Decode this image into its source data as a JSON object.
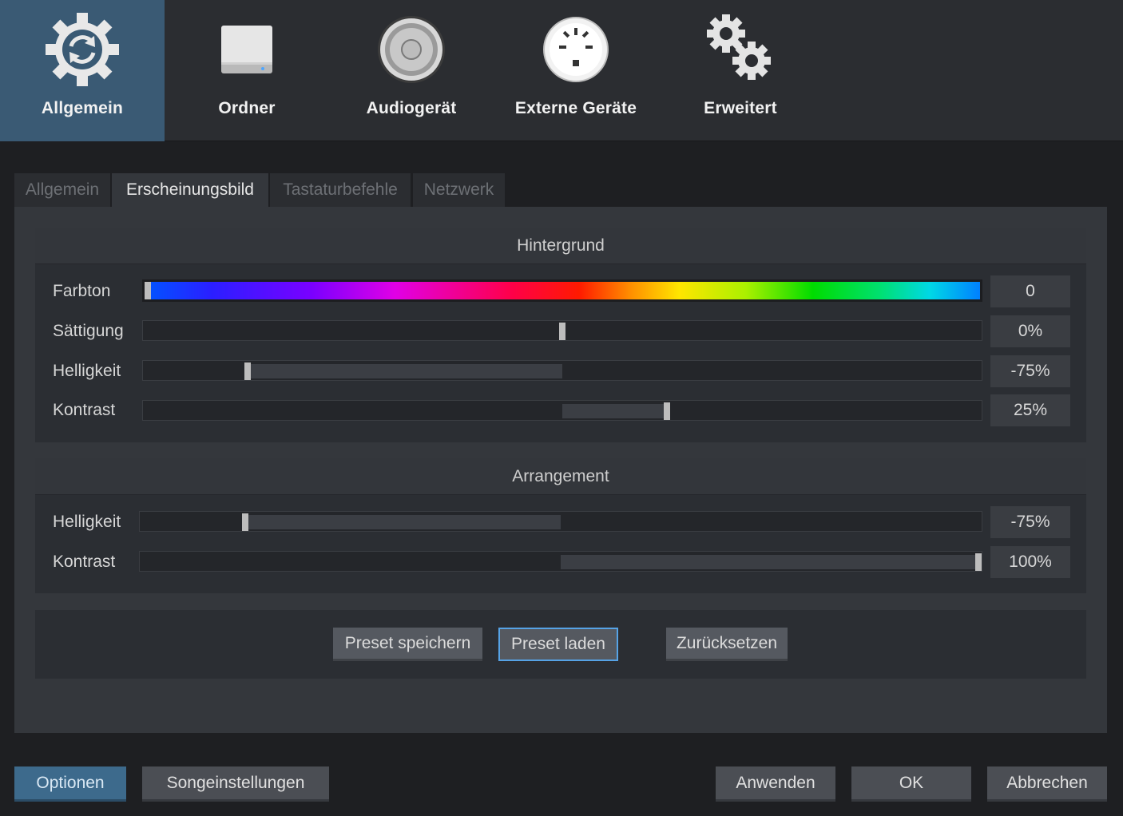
{
  "categories": [
    {
      "label": "Allgemein",
      "icon": "sync-gear-icon",
      "active": true
    },
    {
      "label": "Ordner",
      "icon": "drive-icon"
    },
    {
      "label": "Audiogerät",
      "icon": "speaker-icon"
    },
    {
      "label": "Externe Geräte",
      "icon": "midi-port-icon"
    },
    {
      "label": "Erweitert",
      "icon": "gears-icon"
    }
  ],
  "tabs": [
    {
      "label": "Allgemein"
    },
    {
      "label": "Erscheinungsbild",
      "active": true
    },
    {
      "label": "Tastaturbefehle"
    },
    {
      "label": "Netzwerk"
    }
  ],
  "background": {
    "title": "Hintergrund",
    "hue": {
      "label": "Farbton",
      "value": "0",
      "level": 0.0
    },
    "saturation": {
      "label": "Sättigung",
      "value": "0%",
      "level": 0.5
    },
    "brightness": {
      "label": "Helligkeit",
      "value": "-75%",
      "level": 0.125
    },
    "contrast": {
      "label": "Kontrast",
      "value": "25%",
      "level": 0.625
    }
  },
  "arrangement": {
    "title": "Arrangement",
    "brightness": {
      "label": "Helligkeit",
      "value": "-75%",
      "level": 0.125
    },
    "contrast": {
      "label": "Kontrast",
      "value": "100%",
      "level": 1.0
    }
  },
  "presets": {
    "save": "Preset speichern",
    "load": "Preset laden",
    "reset": "Zurücksetzen"
  },
  "footer": {
    "options": "Optionen",
    "song_settings": "Songeinstellungen",
    "apply": "Anwenden",
    "ok": "OK",
    "cancel": "Abbrechen"
  },
  "colors": {
    "accent": "#3a5a74",
    "focus": "#56a3e6"
  }
}
